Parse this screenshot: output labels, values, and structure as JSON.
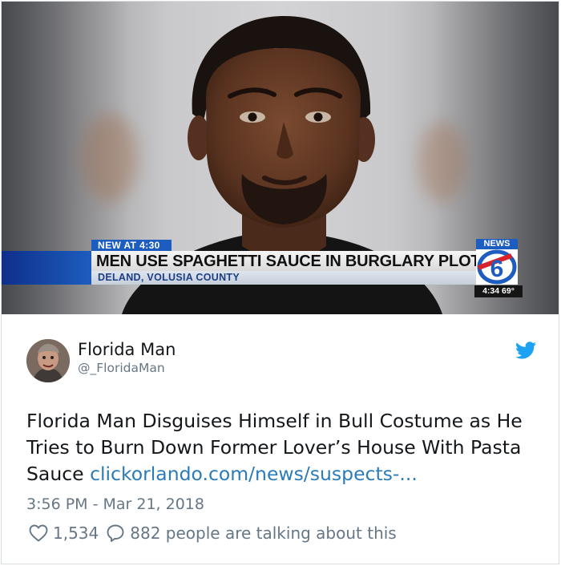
{
  "media": {
    "tag": "NEW AT 4:30",
    "headline": "MEN USE SPAGHETTI SAUCE IN BURGLARY PLOT",
    "subline": "DELAND, VOLUSIA COUNTY",
    "station_label": "NEWS",
    "station_number": "6",
    "clock": "4:34  69°"
  },
  "tweet": {
    "author_name": "Florida Man",
    "author_handle": "@_FloridaMan",
    "text": "Florida Man Disguises Himself in Bull Costume as He Tries to Burn Down Former Lover’s House With Pasta Sauce ",
    "link": "clickorlando.com/news/suspects-...",
    "timestamp": "3:56 PM - Mar 21, 2018",
    "likes": "1,534",
    "talking": "882 people are talking about this"
  },
  "icons": {
    "brand": "twitter-bird-icon",
    "like": "heart-outline-icon",
    "reply": "speech-bubble-icon"
  },
  "colors": {
    "twitter_blue": "#1da1f2",
    "link": "#2b7bb9",
    "muted": "#657786",
    "news_blue": "#1d5dbf"
  }
}
